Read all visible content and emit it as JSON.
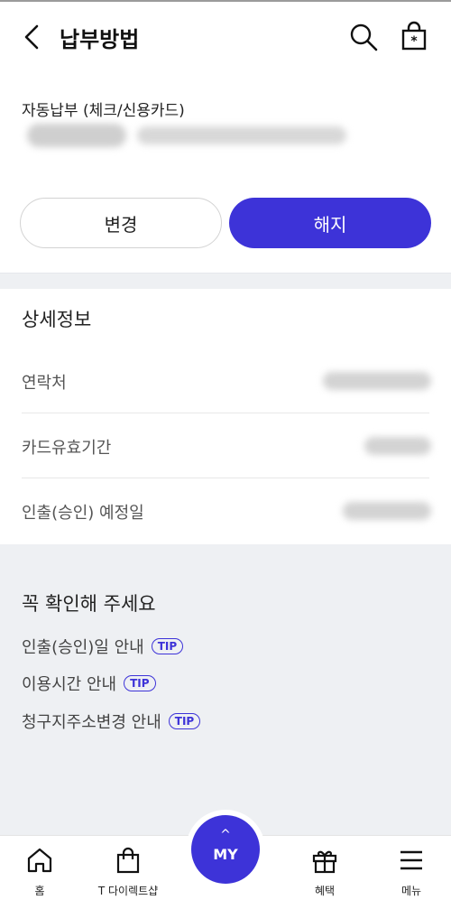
{
  "header": {
    "title": "납부방법"
  },
  "payment": {
    "method_label": "자동납부 (체크/신용카드)",
    "change_label": "변경",
    "cancel_label": "해지"
  },
  "details": {
    "title": "상세정보",
    "rows": [
      {
        "label": "연락처"
      },
      {
        "label": "카드유효기간"
      },
      {
        "label": "인출(승인) 예정일"
      }
    ]
  },
  "notice": {
    "title": "꼭 확인해 주세요",
    "items": [
      {
        "label": "인출(승인)일 안내",
        "tip": "TIP"
      },
      {
        "label": "이용시간 안내",
        "tip": "TIP"
      },
      {
        "label": "청구지주소변경 안내",
        "tip": "TIP"
      }
    ]
  },
  "nav": {
    "home": "홈",
    "shop": "T 다이렉트샵",
    "my": "MY",
    "my_caret": "^",
    "benefits": "혜택",
    "menu": "메뉴"
  },
  "colors": {
    "accent": "#3d33d8",
    "section_bg": "#eef0f3"
  }
}
